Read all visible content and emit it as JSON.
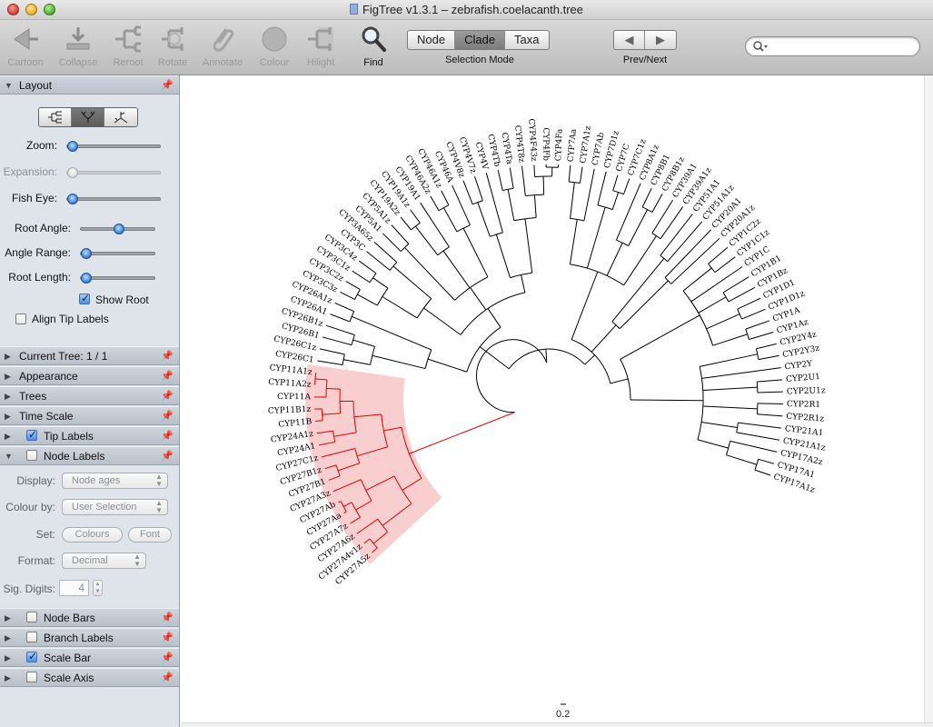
{
  "window": {
    "title": "FigTree v1.3.1 – zebrafish.coelacanth.tree"
  },
  "toolbar": {
    "tools": [
      {
        "label": "Cartoon",
        "icon": "cartoon-icon",
        "enabled": false
      },
      {
        "label": "Collapse",
        "icon": "collapse-icon",
        "enabled": false
      },
      {
        "label": "Reroot",
        "icon": "reroot-icon",
        "enabled": false
      },
      {
        "label": "Rotate",
        "icon": "rotate-icon",
        "enabled": false
      },
      {
        "label": "Annotate",
        "icon": "paperclip-icon",
        "enabled": false
      },
      {
        "label": "Colour",
        "icon": "colour-icon",
        "enabled": false
      },
      {
        "label": "Hilight",
        "icon": "hilight-icon",
        "enabled": false
      },
      {
        "label": "Find",
        "icon": "magnifier-icon",
        "enabled": true
      }
    ],
    "selection_mode": {
      "label": "Selection Mode",
      "options": [
        "Node",
        "Clade",
        "Taxa"
      ],
      "selected": "Clade"
    },
    "prev_next": {
      "label": "Prev/Next",
      "prev_icon": "arrow-left-icon",
      "next_icon": "arrow-right-icon"
    },
    "search": {
      "placeholder": "",
      "value": ""
    }
  },
  "sidepanel": {
    "layout": {
      "title": "Layout",
      "layout_types": [
        "rectangular-tree-icon",
        "polar-tree-icon",
        "radial-tree-icon"
      ],
      "selected_layout": "polar-tree-icon",
      "sliders": [
        {
          "label": "Zoom:",
          "enabled": true,
          "level": 0.0
        },
        {
          "label": "Expansion:",
          "enabled": false,
          "level": 0.0
        },
        {
          "label": "Fish Eye:",
          "enabled": true,
          "level": 0.0
        },
        {
          "label": "Root Angle:",
          "enabled": true,
          "level": 0.5
        },
        {
          "label": "Angle Range:",
          "enabled": true,
          "level": 0.0
        },
        {
          "label": "Root Length:",
          "enabled": true,
          "level": 0.0
        }
      ],
      "show_root": {
        "label": "Show Root",
        "checked": true
      },
      "align_tip_labels": {
        "label": "Align Tip Labels",
        "checked": false
      }
    },
    "panels": [
      {
        "title": "Current Tree: 1 / 1",
        "has_checkbox": false,
        "checked": false,
        "expanded": false
      },
      {
        "title": "Appearance",
        "has_checkbox": false,
        "checked": false,
        "expanded": false
      },
      {
        "title": "Trees",
        "has_checkbox": false,
        "checked": false,
        "expanded": false
      },
      {
        "title": "Time Scale",
        "has_checkbox": false,
        "checked": false,
        "expanded": false
      },
      {
        "title": "Tip Labels",
        "has_checkbox": true,
        "checked": true,
        "expanded": false
      },
      {
        "title": "Node Labels",
        "has_checkbox": true,
        "checked": false,
        "expanded": true
      }
    ],
    "node_labels": {
      "display_label": "Display:",
      "display_value": "Node ages",
      "colour_by_label": "Colour by:",
      "colour_by_value": "User Selection",
      "set_label": "Set:",
      "colours_button": "Colours",
      "font_button": "Font",
      "format_label": "Format:",
      "format_value": "Decimal",
      "sig_digits_label": "Sig. Digits:",
      "sig_digits_value": "4"
    },
    "panels_bottom": [
      {
        "title": "Node Bars",
        "checked": false
      },
      {
        "title": "Branch Labels",
        "checked": false
      },
      {
        "title": "Scale Bar",
        "checked": true
      },
      {
        "title": "Scale Axis",
        "checked": false
      }
    ]
  },
  "tree": {
    "scale_bar_label": "0.2",
    "highlight_color": "#f8c9c9",
    "selected_branch_color": "#e00000",
    "tips": [
      "CYP27A5z",
      "CYP27A4v1z",
      "CYP27A6z",
      "CYP27A7z",
      "CYP27Aa",
      "CYP27Ab",
      "CYP27A3z",
      "CYP27B1",
      "CYP27B1z",
      "CYP27C1z",
      "CYP24A1",
      "CYP24A1z",
      "CYP11B",
      "CYP11B1z",
      "CYP11A",
      "CYP11A2z",
      "CYP11A1z",
      "CYP26C1",
      "CYP26C1z",
      "CYP26B1",
      "CYP26B1z",
      "CYP26A1",
      "CYP26A1z",
      "CYP3C3z",
      "CYP3C2z",
      "CYP3C1z",
      "CYP3C4z",
      "CYP3C",
      "CYP3A65z",
      "CYP5A1",
      "CYP5A1z",
      "CYP19A2z",
      "CYP19A1z",
      "CYP19A1",
      "CYP46A2z",
      "CYP46A1z",
      "CYP46A",
      "CYP4V8z",
      "CYP4V7z",
      "CYP4V",
      "CYP4Tb",
      "CYP4Ta",
      "CYP4T8z",
      "CYP4F43z",
      "CYP4Fb",
      "CYP4Fa",
      "CYP7Aa",
      "CYP7A1z",
      "CYP7Ab",
      "CYP7D1z",
      "CYP7C",
      "CYP7C1z",
      "CYP8A1z",
      "CYP8B1",
      "CYP8B1z",
      "CYP39A1",
      "CYP39A1z",
      "CYP51A1",
      "CYP51A1z",
      "CYP20A1",
      "CYP20A1z",
      "CYP1C2z",
      "CYP1C1z",
      "CYP1C",
      "CYP1B1",
      "CYP1Bz",
      "CYP1D1",
      "CYP1D1z",
      "CYP1A",
      "CYP1Az",
      "CYP2Y4z",
      "CYP2Y3z",
      "CYP2Y",
      "CYP2U1",
      "CYP2U1z",
      "CYP2R1",
      "CYP2R1z",
      "CYP21A1",
      "CYP21A1z",
      "CYP17A2z",
      "CYP17A1",
      "CYP17A1z"
    ]
  }
}
